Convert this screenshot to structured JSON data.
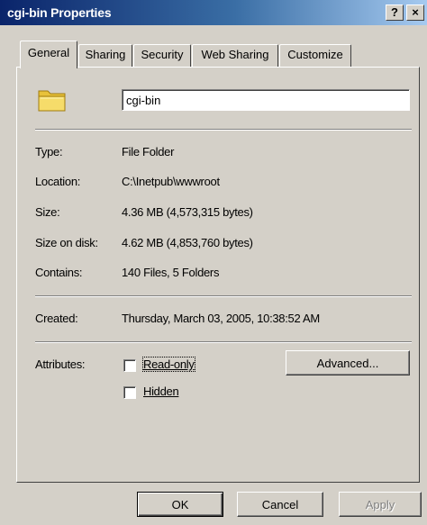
{
  "window": {
    "title": "cgi-bin Properties",
    "help_glyph": "?",
    "close_glyph": "×"
  },
  "tabs": [
    {
      "label": "General",
      "active": true
    },
    {
      "label": "Sharing",
      "active": false
    },
    {
      "label": "Security",
      "active": false
    },
    {
      "label": "Web Sharing",
      "active": false
    },
    {
      "label": "Customize",
      "active": false
    }
  ],
  "general": {
    "icon": "folder-icon",
    "name_value": "cgi-bin",
    "rows": [
      {
        "label": "Type:",
        "value": "File Folder"
      },
      {
        "label": "Location:",
        "value": "C:\\Inetpub\\wwwroot"
      },
      {
        "label": "Size:",
        "value": "4.36 MB (4,573,315 bytes)"
      },
      {
        "label": "Size on disk:",
        "value": "4.62 MB (4,853,760 bytes)"
      },
      {
        "label": "Contains:",
        "value": "140 Files, 5 Folders"
      }
    ],
    "created": {
      "label": "Created:",
      "value": "Thursday, March 03, 2005, 10:38:52 AM"
    },
    "attributes": {
      "label": "Attributes:",
      "readonly": {
        "label": "Read-only",
        "checked": false
      },
      "hidden": {
        "label": "Hidden",
        "checked": false
      },
      "advanced_label": "Advanced..."
    }
  },
  "footer": {
    "ok_label": "OK",
    "cancel_label": "Cancel",
    "apply_label": "Apply"
  },
  "colors": {
    "face": "#d4d0c8",
    "title_start": "#0a246a",
    "title_end": "#a6caf0",
    "folder": "#f2d24a"
  }
}
